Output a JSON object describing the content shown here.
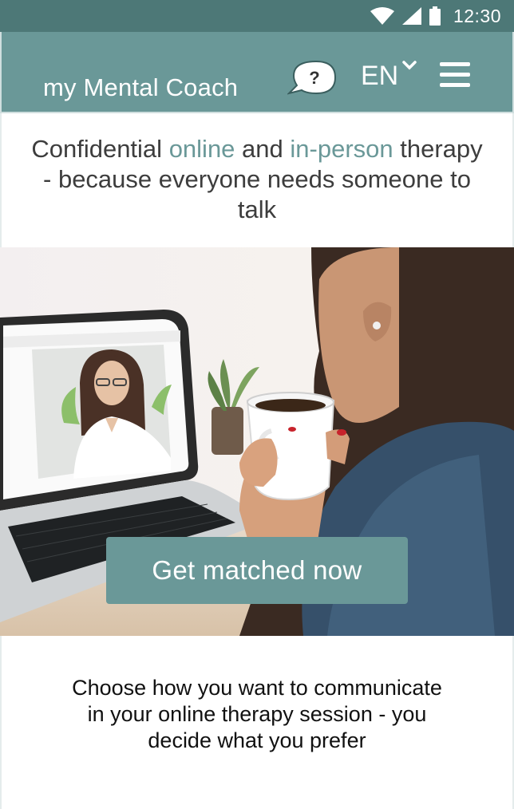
{
  "status_bar": {
    "time": "12:30"
  },
  "header": {
    "brand": "my Mental Coach",
    "help_glyph": "?",
    "language": "EN",
    "icons": [
      "help-bubble-icon",
      "chevron-down-icon",
      "hamburger-menu-icon"
    ]
  },
  "headline": {
    "part1": "Confidential ",
    "online": "online",
    "part2": " and ",
    "in_person": "in-person",
    "part3": " therapy - because everyone needs someone to talk"
  },
  "hero": {
    "cta_label": "Get matched now"
  },
  "section": {
    "text": "Choose how you want to communicate in your online therapy session - you decide what you prefer"
  },
  "colors": {
    "status_bar": "#4d7877",
    "header": "#6a9898",
    "accent": "#6a9898",
    "button": "#6a9898"
  }
}
